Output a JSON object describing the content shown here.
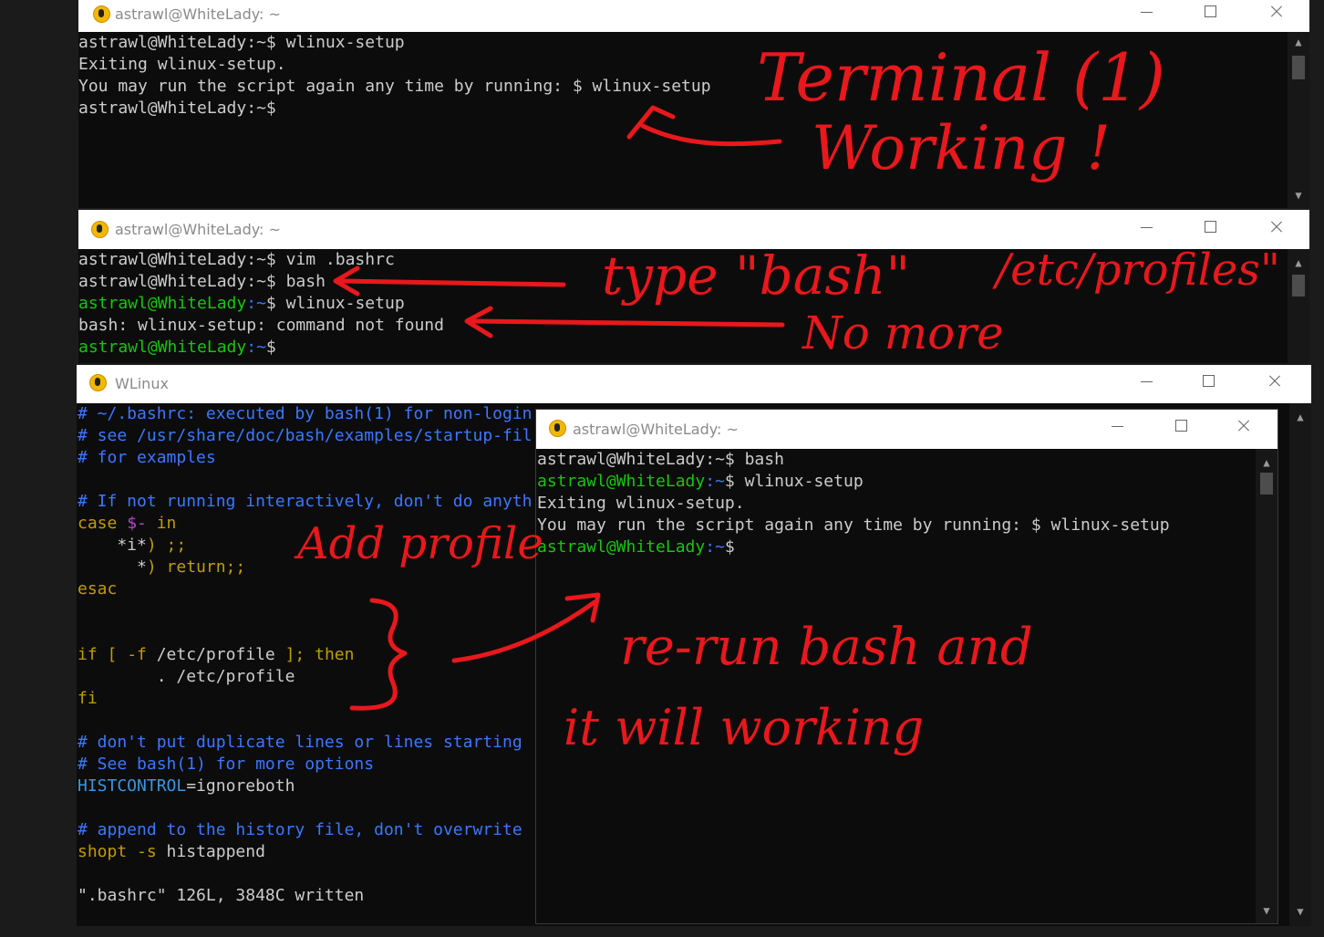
{
  "win1": {
    "title": "astrawl@WhiteLady: ~",
    "lines": [
      {
        "prompt": "astrawl@WhiteLady:~$ ",
        "cmd": "wlinux-setup"
      },
      {
        "text": "Exiting wlinux-setup."
      },
      {
        "text": "You may run the script again any time by running: $ wlinux-setup"
      },
      {
        "prompt": "astrawl@WhiteLady:~$",
        "cmd": ""
      }
    ]
  },
  "win2": {
    "title": "astrawl@WhiteLady: ~",
    "lines": [
      {
        "prompt": "astrawl@WhiteLady:~$ ",
        "cmd": "vim .bashrc"
      },
      {
        "prompt": "astrawl@WhiteLady:~$ ",
        "cmd": "bash"
      },
      {
        "user": "astrawl@WhiteLady",
        "path": ":~",
        "sym": "$ ",
        "cmd": "wlinux-setup"
      },
      {
        "text": "bash: wlinux-setup: command not found"
      },
      {
        "user": "astrawl@WhiteLady",
        "path": ":~",
        "sym": "$",
        "cmd": ""
      }
    ]
  },
  "win3": {
    "title": "WLinux",
    "lines": {
      "l1": "# ~/.bashrc: executed by bash(1) for non-login",
      "l2": "# see /usr/share/doc/bash/examples/startup-fil",
      "l3": "# for examples",
      "l5": "# If not running interactively, don't do anyth",
      "l6a": "case ",
      "l6b": "$-",
      "l6c": " in",
      "l7a": "    *i*",
      "l7b": ") ;;",
      "l8a": "      *",
      "l8b": ") return;;",
      "l9": "esac",
      "l12a": "if [ ",
      "l12b": "-f",
      "l12c": " /etc/profile ",
      "l12d": "]; then",
      "l13": "        . /etc/profile",
      "l14": "fi",
      "l16": "# don't put duplicate lines or lines starting",
      "l17": "# See bash(1) for more options",
      "l18a": "HISTCONTROL",
      "l18b": "=ignoreboth",
      "l20": "# append to the history file, don't overwrite",
      "l21a": "shopt ",
      "l21b": "-s",
      "l21c": " histappend",
      "l23": "\".bashrc\" 126L, 3848C written"
    }
  },
  "win4": {
    "title": "astrawl@WhiteLady: ~",
    "lines": [
      {
        "prompt": "astrawl@WhiteLady:~$ ",
        "cmd": "bash"
      },
      {
        "user": "astrawl@WhiteLady",
        "path": ":~",
        "sym": "$ ",
        "cmd": "wlinux-setup"
      },
      {
        "text": "Exiting wlinux-setup."
      },
      {
        "text": "You may run the script again any time by running: $ wlinux-setup"
      },
      {
        "user": "astrawl@WhiteLady",
        "path": ":~",
        "sym": "$",
        "cmd": ""
      }
    ]
  },
  "annotations": {
    "a1": "Terminal (1)",
    "a2": "Working !",
    "a3": "type \"bash\"",
    "a4": "/etc/profiles\"",
    "a5": "No more",
    "a6": "Add profile",
    "a7": "re-run bash  and",
    "a8": "it will working"
  },
  "colors": {
    "annotation": "#e8181c",
    "prompt_green": "#16c60c",
    "path_blue": "#3b78ff",
    "comment_blue": "#3b78ff",
    "keyword_orange": "#c19c00"
  }
}
